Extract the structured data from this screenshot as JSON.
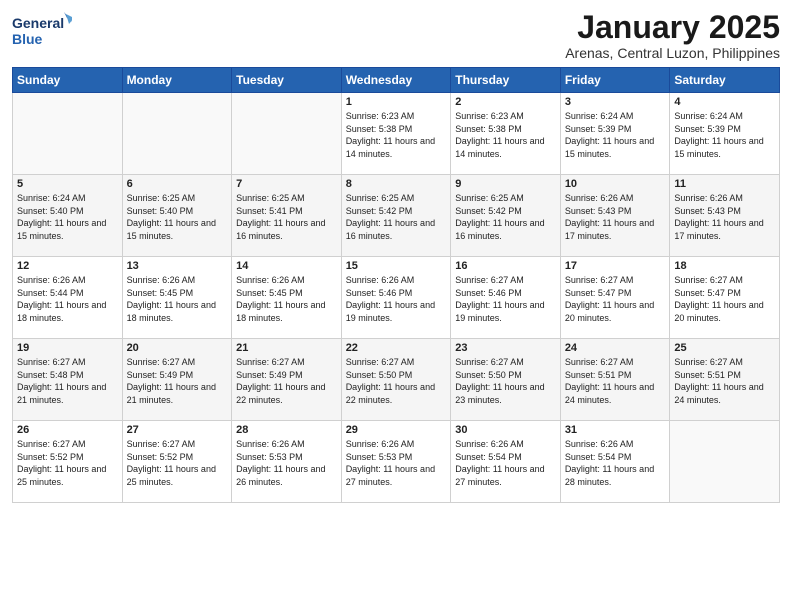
{
  "logo": {
    "line1": "General",
    "line2": "Blue"
  },
  "title": "January 2025",
  "subtitle": "Arenas, Central Luzon, Philippines",
  "days_header": [
    "Sunday",
    "Monday",
    "Tuesday",
    "Wednesday",
    "Thursday",
    "Friday",
    "Saturday"
  ],
  "weeks": [
    [
      {
        "day": "",
        "sunrise": "",
        "sunset": "",
        "daylight": ""
      },
      {
        "day": "",
        "sunrise": "",
        "sunset": "",
        "daylight": ""
      },
      {
        "day": "",
        "sunrise": "",
        "sunset": "",
        "daylight": ""
      },
      {
        "day": "1",
        "sunrise": "Sunrise: 6:23 AM",
        "sunset": "Sunset: 5:38 PM",
        "daylight": "Daylight: 11 hours and 14 minutes."
      },
      {
        "day": "2",
        "sunrise": "Sunrise: 6:23 AM",
        "sunset": "Sunset: 5:38 PM",
        "daylight": "Daylight: 11 hours and 14 minutes."
      },
      {
        "day": "3",
        "sunrise": "Sunrise: 6:24 AM",
        "sunset": "Sunset: 5:39 PM",
        "daylight": "Daylight: 11 hours and 15 minutes."
      },
      {
        "day": "4",
        "sunrise": "Sunrise: 6:24 AM",
        "sunset": "Sunset: 5:39 PM",
        "daylight": "Daylight: 11 hours and 15 minutes."
      }
    ],
    [
      {
        "day": "5",
        "sunrise": "Sunrise: 6:24 AM",
        "sunset": "Sunset: 5:40 PM",
        "daylight": "Daylight: 11 hours and 15 minutes."
      },
      {
        "day": "6",
        "sunrise": "Sunrise: 6:25 AM",
        "sunset": "Sunset: 5:40 PM",
        "daylight": "Daylight: 11 hours and 15 minutes."
      },
      {
        "day": "7",
        "sunrise": "Sunrise: 6:25 AM",
        "sunset": "Sunset: 5:41 PM",
        "daylight": "Daylight: 11 hours and 16 minutes."
      },
      {
        "day": "8",
        "sunrise": "Sunrise: 6:25 AM",
        "sunset": "Sunset: 5:42 PM",
        "daylight": "Daylight: 11 hours and 16 minutes."
      },
      {
        "day": "9",
        "sunrise": "Sunrise: 6:25 AM",
        "sunset": "Sunset: 5:42 PM",
        "daylight": "Daylight: 11 hours and 16 minutes."
      },
      {
        "day": "10",
        "sunrise": "Sunrise: 6:26 AM",
        "sunset": "Sunset: 5:43 PM",
        "daylight": "Daylight: 11 hours and 17 minutes."
      },
      {
        "day": "11",
        "sunrise": "Sunrise: 6:26 AM",
        "sunset": "Sunset: 5:43 PM",
        "daylight": "Daylight: 11 hours and 17 minutes."
      }
    ],
    [
      {
        "day": "12",
        "sunrise": "Sunrise: 6:26 AM",
        "sunset": "Sunset: 5:44 PM",
        "daylight": "Daylight: 11 hours and 18 minutes."
      },
      {
        "day": "13",
        "sunrise": "Sunrise: 6:26 AM",
        "sunset": "Sunset: 5:45 PM",
        "daylight": "Daylight: 11 hours and 18 minutes."
      },
      {
        "day": "14",
        "sunrise": "Sunrise: 6:26 AM",
        "sunset": "Sunset: 5:45 PM",
        "daylight": "Daylight: 11 hours and 18 minutes."
      },
      {
        "day": "15",
        "sunrise": "Sunrise: 6:26 AM",
        "sunset": "Sunset: 5:46 PM",
        "daylight": "Daylight: 11 hours and 19 minutes."
      },
      {
        "day": "16",
        "sunrise": "Sunrise: 6:27 AM",
        "sunset": "Sunset: 5:46 PM",
        "daylight": "Daylight: 11 hours and 19 minutes."
      },
      {
        "day": "17",
        "sunrise": "Sunrise: 6:27 AM",
        "sunset": "Sunset: 5:47 PM",
        "daylight": "Daylight: 11 hours and 20 minutes."
      },
      {
        "day": "18",
        "sunrise": "Sunrise: 6:27 AM",
        "sunset": "Sunset: 5:47 PM",
        "daylight": "Daylight: 11 hours and 20 minutes."
      }
    ],
    [
      {
        "day": "19",
        "sunrise": "Sunrise: 6:27 AM",
        "sunset": "Sunset: 5:48 PM",
        "daylight": "Daylight: 11 hours and 21 minutes."
      },
      {
        "day": "20",
        "sunrise": "Sunrise: 6:27 AM",
        "sunset": "Sunset: 5:49 PM",
        "daylight": "Daylight: 11 hours and 21 minutes."
      },
      {
        "day": "21",
        "sunrise": "Sunrise: 6:27 AM",
        "sunset": "Sunset: 5:49 PM",
        "daylight": "Daylight: 11 hours and 22 minutes."
      },
      {
        "day": "22",
        "sunrise": "Sunrise: 6:27 AM",
        "sunset": "Sunset: 5:50 PM",
        "daylight": "Daylight: 11 hours and 22 minutes."
      },
      {
        "day": "23",
        "sunrise": "Sunrise: 6:27 AM",
        "sunset": "Sunset: 5:50 PM",
        "daylight": "Daylight: 11 hours and 23 minutes."
      },
      {
        "day": "24",
        "sunrise": "Sunrise: 6:27 AM",
        "sunset": "Sunset: 5:51 PM",
        "daylight": "Daylight: 11 hours and 24 minutes."
      },
      {
        "day": "25",
        "sunrise": "Sunrise: 6:27 AM",
        "sunset": "Sunset: 5:51 PM",
        "daylight": "Daylight: 11 hours and 24 minutes."
      }
    ],
    [
      {
        "day": "26",
        "sunrise": "Sunrise: 6:27 AM",
        "sunset": "Sunset: 5:52 PM",
        "daylight": "Daylight: 11 hours and 25 minutes."
      },
      {
        "day": "27",
        "sunrise": "Sunrise: 6:27 AM",
        "sunset": "Sunset: 5:52 PM",
        "daylight": "Daylight: 11 hours and 25 minutes."
      },
      {
        "day": "28",
        "sunrise": "Sunrise: 6:26 AM",
        "sunset": "Sunset: 5:53 PM",
        "daylight": "Daylight: 11 hours and 26 minutes."
      },
      {
        "day": "29",
        "sunrise": "Sunrise: 6:26 AM",
        "sunset": "Sunset: 5:53 PM",
        "daylight": "Daylight: 11 hours and 27 minutes."
      },
      {
        "day": "30",
        "sunrise": "Sunrise: 6:26 AM",
        "sunset": "Sunset: 5:54 PM",
        "daylight": "Daylight: 11 hours and 27 minutes."
      },
      {
        "day": "31",
        "sunrise": "Sunrise: 6:26 AM",
        "sunset": "Sunset: 5:54 PM",
        "daylight": "Daylight: 11 hours and 28 minutes."
      },
      {
        "day": "",
        "sunrise": "",
        "sunset": "",
        "daylight": ""
      }
    ]
  ]
}
